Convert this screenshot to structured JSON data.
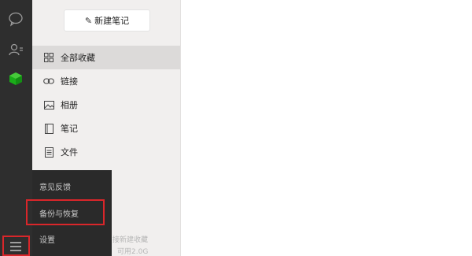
{
  "sidebar": {
    "icons": [
      "chat-icon",
      "contacts-icon",
      "favorites-cube-icon",
      "menu-icon"
    ],
    "accent": "#1aad19"
  },
  "panel": {
    "new_note_label": "新建笔记",
    "nav": [
      {
        "label": "全部收藏",
        "icon": "grid-icon",
        "active": true
      },
      {
        "label": "链接",
        "icon": "link-icon",
        "active": false
      },
      {
        "label": "相册",
        "icon": "image-icon",
        "active": false
      },
      {
        "label": "笔记",
        "icon": "notebook-icon",
        "active": false
      },
      {
        "label": "文件",
        "icon": "file-icon",
        "active": false
      }
    ],
    "footer_text": "接新建收藏",
    "storage_text": "可用2.0G"
  },
  "menu": {
    "items": [
      "意见反馈",
      "备份与恢复",
      "设置"
    ],
    "highlight_color": "#d9262a"
  }
}
